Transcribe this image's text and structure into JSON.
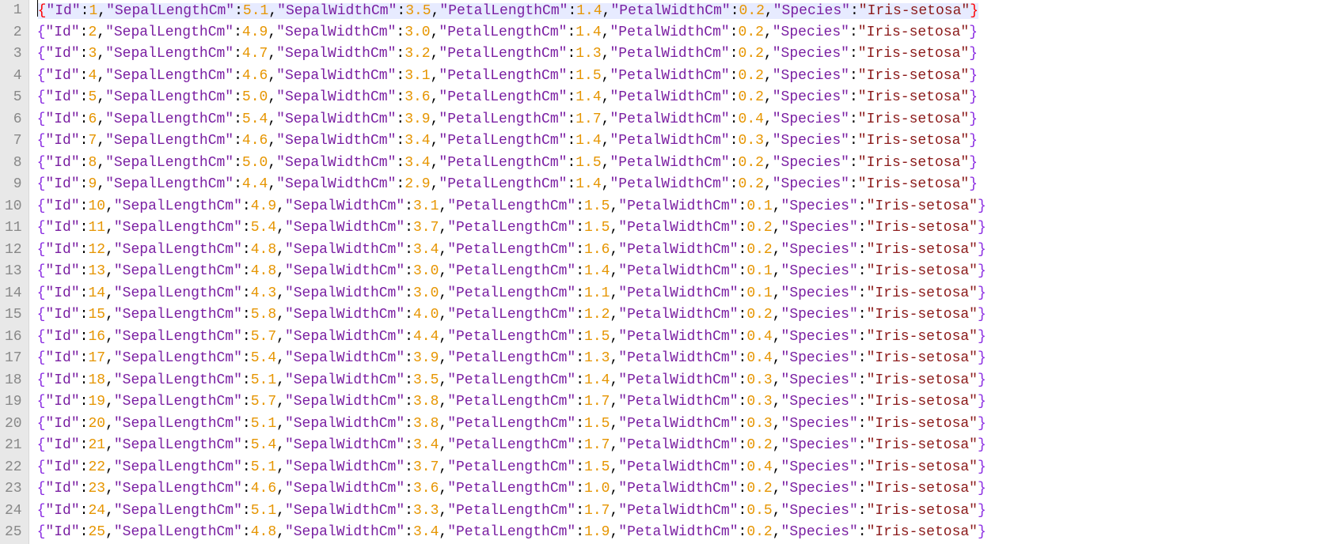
{
  "editor": {
    "selected_line_index": 0,
    "caret_offset_chars": 0,
    "keys": [
      "Id",
      "SepalLengthCm",
      "SepalWidthCm",
      "PetalLengthCm",
      "PetalWidthCm",
      "Species"
    ],
    "rows": [
      {
        "Id": 1,
        "SepalLengthCm": 5.1,
        "SepalWidthCm": 3.5,
        "PetalLengthCm": 1.4,
        "PetalWidthCm": 0.2,
        "Species": "Iris-setosa"
      },
      {
        "Id": 2,
        "SepalLengthCm": 4.9,
        "SepalWidthCm": 3.0,
        "PetalLengthCm": 1.4,
        "PetalWidthCm": 0.2,
        "Species": "Iris-setosa"
      },
      {
        "Id": 3,
        "SepalLengthCm": 4.7,
        "SepalWidthCm": 3.2,
        "PetalLengthCm": 1.3,
        "PetalWidthCm": 0.2,
        "Species": "Iris-setosa"
      },
      {
        "Id": 4,
        "SepalLengthCm": 4.6,
        "SepalWidthCm": 3.1,
        "PetalLengthCm": 1.5,
        "PetalWidthCm": 0.2,
        "Species": "Iris-setosa"
      },
      {
        "Id": 5,
        "SepalLengthCm": 5.0,
        "SepalWidthCm": 3.6,
        "PetalLengthCm": 1.4,
        "PetalWidthCm": 0.2,
        "Species": "Iris-setosa"
      },
      {
        "Id": 6,
        "SepalLengthCm": 5.4,
        "SepalWidthCm": 3.9,
        "PetalLengthCm": 1.7,
        "PetalWidthCm": 0.4,
        "Species": "Iris-setosa"
      },
      {
        "Id": 7,
        "SepalLengthCm": 4.6,
        "SepalWidthCm": 3.4,
        "PetalLengthCm": 1.4,
        "PetalWidthCm": 0.3,
        "Species": "Iris-setosa"
      },
      {
        "Id": 8,
        "SepalLengthCm": 5.0,
        "SepalWidthCm": 3.4,
        "PetalLengthCm": 1.5,
        "PetalWidthCm": 0.2,
        "Species": "Iris-setosa"
      },
      {
        "Id": 9,
        "SepalLengthCm": 4.4,
        "SepalWidthCm": 2.9,
        "PetalLengthCm": 1.4,
        "PetalWidthCm": 0.2,
        "Species": "Iris-setosa"
      },
      {
        "Id": 10,
        "SepalLengthCm": 4.9,
        "SepalWidthCm": 3.1,
        "PetalLengthCm": 1.5,
        "PetalWidthCm": 0.1,
        "Species": "Iris-setosa"
      },
      {
        "Id": 11,
        "SepalLengthCm": 5.4,
        "SepalWidthCm": 3.7,
        "PetalLengthCm": 1.5,
        "PetalWidthCm": 0.2,
        "Species": "Iris-setosa"
      },
      {
        "Id": 12,
        "SepalLengthCm": 4.8,
        "SepalWidthCm": 3.4,
        "PetalLengthCm": 1.6,
        "PetalWidthCm": 0.2,
        "Species": "Iris-setosa"
      },
      {
        "Id": 13,
        "SepalLengthCm": 4.8,
        "SepalWidthCm": 3.0,
        "PetalLengthCm": 1.4,
        "PetalWidthCm": 0.1,
        "Species": "Iris-setosa"
      },
      {
        "Id": 14,
        "SepalLengthCm": 4.3,
        "SepalWidthCm": 3.0,
        "PetalLengthCm": 1.1,
        "PetalWidthCm": 0.1,
        "Species": "Iris-setosa"
      },
      {
        "Id": 15,
        "SepalLengthCm": 5.8,
        "SepalWidthCm": 4.0,
        "PetalLengthCm": 1.2,
        "PetalWidthCm": 0.2,
        "Species": "Iris-setosa"
      },
      {
        "Id": 16,
        "SepalLengthCm": 5.7,
        "SepalWidthCm": 4.4,
        "PetalLengthCm": 1.5,
        "PetalWidthCm": 0.4,
        "Species": "Iris-setosa"
      },
      {
        "Id": 17,
        "SepalLengthCm": 5.4,
        "SepalWidthCm": 3.9,
        "PetalLengthCm": 1.3,
        "PetalWidthCm": 0.4,
        "Species": "Iris-setosa"
      },
      {
        "Id": 18,
        "SepalLengthCm": 5.1,
        "SepalWidthCm": 3.5,
        "PetalLengthCm": 1.4,
        "PetalWidthCm": 0.3,
        "Species": "Iris-setosa"
      },
      {
        "Id": 19,
        "SepalLengthCm": 5.7,
        "SepalWidthCm": 3.8,
        "PetalLengthCm": 1.7,
        "PetalWidthCm": 0.3,
        "Species": "Iris-setosa"
      },
      {
        "Id": 20,
        "SepalLengthCm": 5.1,
        "SepalWidthCm": 3.8,
        "PetalLengthCm": 1.5,
        "PetalWidthCm": 0.3,
        "Species": "Iris-setosa"
      },
      {
        "Id": 21,
        "SepalLengthCm": 5.4,
        "SepalWidthCm": 3.4,
        "PetalLengthCm": 1.7,
        "PetalWidthCm": 0.2,
        "Species": "Iris-setosa"
      },
      {
        "Id": 22,
        "SepalLengthCm": 5.1,
        "SepalWidthCm": 3.7,
        "PetalLengthCm": 1.5,
        "PetalWidthCm": 0.4,
        "Species": "Iris-setosa"
      },
      {
        "Id": 23,
        "SepalLengthCm": 4.6,
        "SepalWidthCm": 3.6,
        "PetalLengthCm": 1.0,
        "PetalWidthCm": 0.2,
        "Species": "Iris-setosa"
      },
      {
        "Id": 24,
        "SepalLengthCm": 5.1,
        "SepalWidthCm": 3.3,
        "PetalLengthCm": 1.7,
        "PetalWidthCm": 0.5,
        "Species": "Iris-setosa"
      },
      {
        "Id": 25,
        "SepalLengthCm": 4.8,
        "SepalWidthCm": 3.4,
        "PetalLengthCm": 1.9,
        "PetalWidthCm": 0.2,
        "Species": "Iris-setosa"
      }
    ]
  }
}
